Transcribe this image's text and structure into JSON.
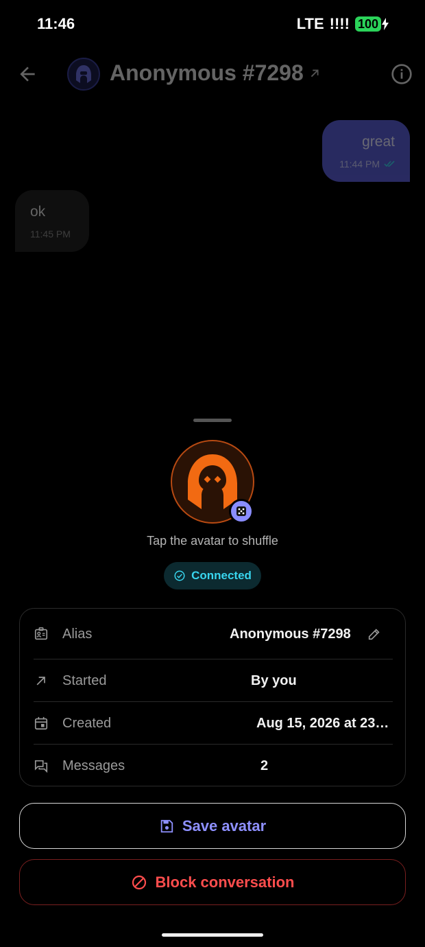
{
  "status_bar": {
    "time": "11:46",
    "network": "LTE",
    "signal": "!!!!",
    "battery": "100"
  },
  "header": {
    "title": "Anonymous #7298"
  },
  "messages": [
    {
      "direction": "out",
      "text": "great",
      "time": "11:44 PM"
    },
    {
      "direction": "in",
      "text": "ok",
      "time": "11:45 PM"
    }
  ],
  "sheet": {
    "shuffle_hint": "Tap the avatar to shuffle",
    "status_label": "Connected",
    "details": {
      "alias": {
        "label": "Alias",
        "value": "Anonymous #7298"
      },
      "started": {
        "label": "Started",
        "value": "By you"
      },
      "created": {
        "label": "Created",
        "value": "Aug 15, 2026 at 23…"
      },
      "messages": {
        "label": "Messages",
        "value": "2"
      }
    },
    "save_label": "Save avatar",
    "block_label": "Block conversation"
  },
  "colors": {
    "accent": "#8e90ff",
    "connected": "#38d5ee",
    "danger": "#ff4d4d",
    "avatar_orange": "#f26a12",
    "outgoing_bubble": "#5a5dd6"
  }
}
